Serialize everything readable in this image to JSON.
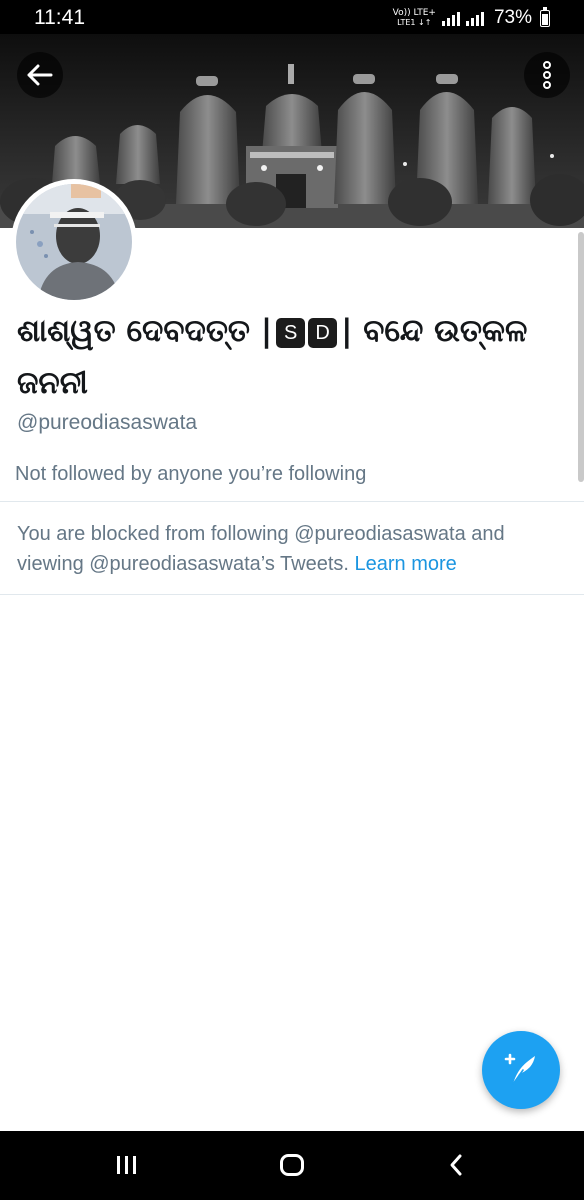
{
  "status_bar": {
    "time": "11:41",
    "network_top": "Vo)) LTE+",
    "network_bottom": "LTE1 ↓↑",
    "battery_percent_text": "73%",
    "battery_level": 0.73
  },
  "header": {
    "back_icon": "arrow-left-icon",
    "more_icon": "vertical-dots-icon"
  },
  "profile": {
    "name_part1": "ଶାଶ୍ୱତ ଦେବଦତ୍ତ |",
    "badge_letters": [
      "S",
      "D"
    ],
    "name_part2": "| ବନ୍ଦେ ଉତ୍କଳ ଜନନୀ",
    "handle": "@pureodiasaswata",
    "followed_note": "Not followed by anyone you’re following"
  },
  "blocked": {
    "message": "You are blocked from following @pureodiasaswata and viewing @pureodiasaswata’s Tweets.",
    "link": "Learn more"
  },
  "fab": {
    "icon": "compose-tweet-icon"
  },
  "nav_bar": {
    "recents_icon": "recents-icon",
    "home_icon": "home-icon",
    "back_icon": "nav-back-icon"
  },
  "colors": {
    "accent": "#1da1f2",
    "link": "#1b95e0",
    "secondary_text": "#657786",
    "divider": "#e1e8ed"
  }
}
